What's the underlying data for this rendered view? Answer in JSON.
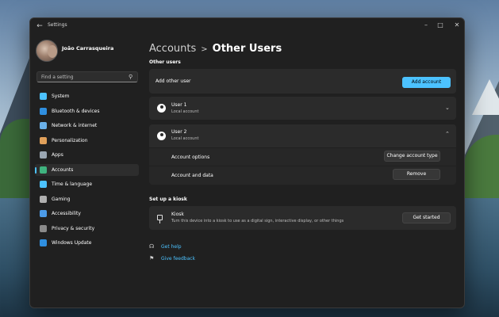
{
  "window": {
    "title": "Settings"
  },
  "profile": {
    "name": "João Carrasqueira"
  },
  "search": {
    "placeholder": "Find a setting"
  },
  "sidebar": {
    "items": [
      {
        "label": "System",
        "icon": "monitor-icon",
        "color": "#4cc2ff"
      },
      {
        "label": "Bluetooth & devices",
        "icon": "bluetooth-icon",
        "color": "#2f8fe0"
      },
      {
        "label": "Network & internet",
        "icon": "wifi-icon",
        "color": "#6ab0e8"
      },
      {
        "label": "Personalization",
        "icon": "brush-icon",
        "color": "#e0a05a"
      },
      {
        "label": "Apps",
        "icon": "apps-icon",
        "color": "#9aa6b2"
      },
      {
        "label": "Accounts",
        "icon": "person-icon",
        "color": "#3fb37f",
        "active": true
      },
      {
        "label": "Time & language",
        "icon": "globe-clock-icon",
        "color": "#4cc2ff"
      },
      {
        "label": "Gaming",
        "icon": "gamepad-icon",
        "color": "#b0b0b0"
      },
      {
        "label": "Accessibility",
        "icon": "accessibility-icon",
        "color": "#4c9be8"
      },
      {
        "label": "Privacy & security",
        "icon": "shield-icon",
        "color": "#8a8a8a"
      },
      {
        "label": "Windows Update",
        "icon": "update-icon",
        "color": "#2f8fe0"
      }
    ]
  },
  "breadcrumb": {
    "parent": "Accounts",
    "separator": ">",
    "current": "Other Users"
  },
  "other_users": {
    "section_title": "Other users",
    "add_label": "Add other user",
    "add_button": "Add account",
    "users": [
      {
        "name": "User 1",
        "type": "Local account",
        "expanded": false
      },
      {
        "name": "User 2",
        "type": "Local account",
        "expanded": true,
        "options_label": "Account options",
        "options_button": "Change account type",
        "data_label": "Account and data",
        "data_button": "Remove"
      }
    ]
  },
  "kiosk": {
    "section_title": "Set up a kiosk",
    "title": "Kiosk",
    "description": "Turn this device into a kiosk to use as a digital sign, interactive display, or other things",
    "button": "Get started"
  },
  "links": {
    "help": "Get help",
    "feedback": "Give feedback"
  },
  "colors": {
    "accent": "#4cc2ff",
    "window_bg": "#202020",
    "card_bg": "#2b2b2b"
  }
}
